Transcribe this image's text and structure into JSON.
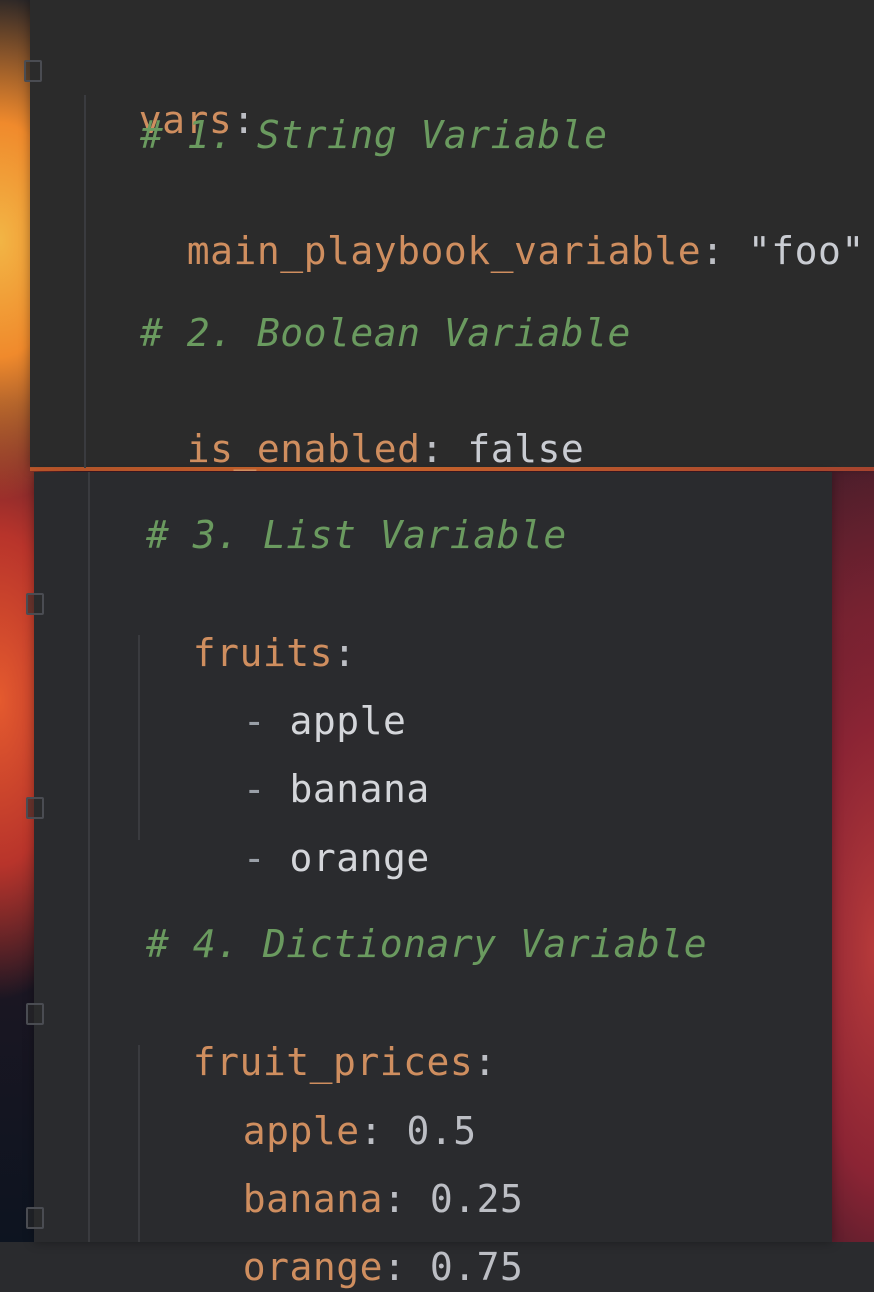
{
  "editor": {
    "lines": {
      "vars_key": "vars",
      "colon": ":",
      "comment1": "# 1. String Variable",
      "str_key": "main_playbook_variable",
      "str_value": "\"foo\"",
      "comment2": "# 2. Boolean Variable",
      "bool_key": "is_enabled",
      "bool_value": "false",
      "comment3": "# 3. List Variable",
      "list_key": "fruits",
      "list_items": [
        "apple",
        "banana",
        "orange"
      ],
      "dash": "-",
      "comment4": "# 4. Dictionary Variable",
      "dict_key": "fruit_prices",
      "dict_items": [
        {
          "key": "apple",
          "value": "0.5"
        },
        {
          "key": "banana",
          "value": "0.25"
        },
        {
          "key": "orange",
          "value": "0.75"
        }
      ]
    }
  },
  "colors": {
    "key": "#cf8e5f",
    "comment": "#6a9a5f",
    "value": "#c9ccd2",
    "background": "#2b2b2b"
  }
}
